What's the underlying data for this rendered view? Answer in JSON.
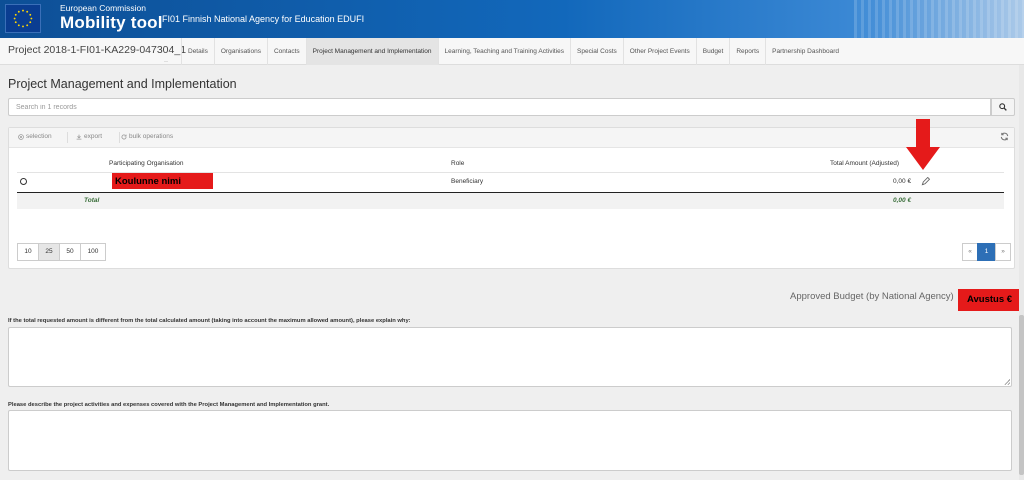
{
  "header": {
    "commission": "European Commission",
    "app_name": "Mobility tool",
    "agency": "FI01 Finnish National Agency for Education EDUFI"
  },
  "nav": {
    "project_id": "Project 2018-1-FI01-KA229-047304_1",
    "tabs": [
      {
        "label": "Details"
      },
      {
        "label": "Organisations"
      },
      {
        "label": "Contacts"
      },
      {
        "label": "Project Management and Implementation"
      },
      {
        "label": "Learning, Teaching and Training Activities"
      },
      {
        "label": "Special Costs"
      },
      {
        "label": "Other Project Events"
      },
      {
        "label": "Budget"
      },
      {
        "label": "Reports"
      },
      {
        "label": "Partnership Dashboard"
      }
    ],
    "active_tab": "Project Management and Implementation"
  },
  "page": {
    "title": "Project Management and Implementation"
  },
  "search": {
    "placeholder": "Search in 1 records",
    "icon": "search-icon"
  },
  "toolbar": {
    "selection": "selection",
    "export": "export",
    "bulk": "bulk operations"
  },
  "table": {
    "headers": {
      "org": "Participating Organisation",
      "role": "Role",
      "amount": "Total Amount (Adjusted)"
    },
    "rows": [
      {
        "org": "Koulunne nimi",
        "role": "Beneficiary",
        "amount": "0,00 €"
      }
    ],
    "total_label": "Total",
    "total_amount": "0,00 €"
  },
  "pagination": {
    "sizes": [
      "10",
      "25",
      "50",
      "100"
    ],
    "active_size": "25",
    "prev": "«",
    "current": "1",
    "next": "»"
  },
  "budget": {
    "approved_label": "Approved Budget (by National Agency)",
    "highlight": "Avustus €"
  },
  "questions": {
    "q1": "If the total requested amount is different from the total calculated amount (taking into account the maximum allowed amount), please explain why:",
    "q2": "Please describe the project activities and expenses covered with the Project Management and Implementation grant."
  },
  "colors": {
    "header_blue": "#1268bb",
    "highlight_red": "#e51a1a",
    "pager_active": "#2d6fb6"
  }
}
